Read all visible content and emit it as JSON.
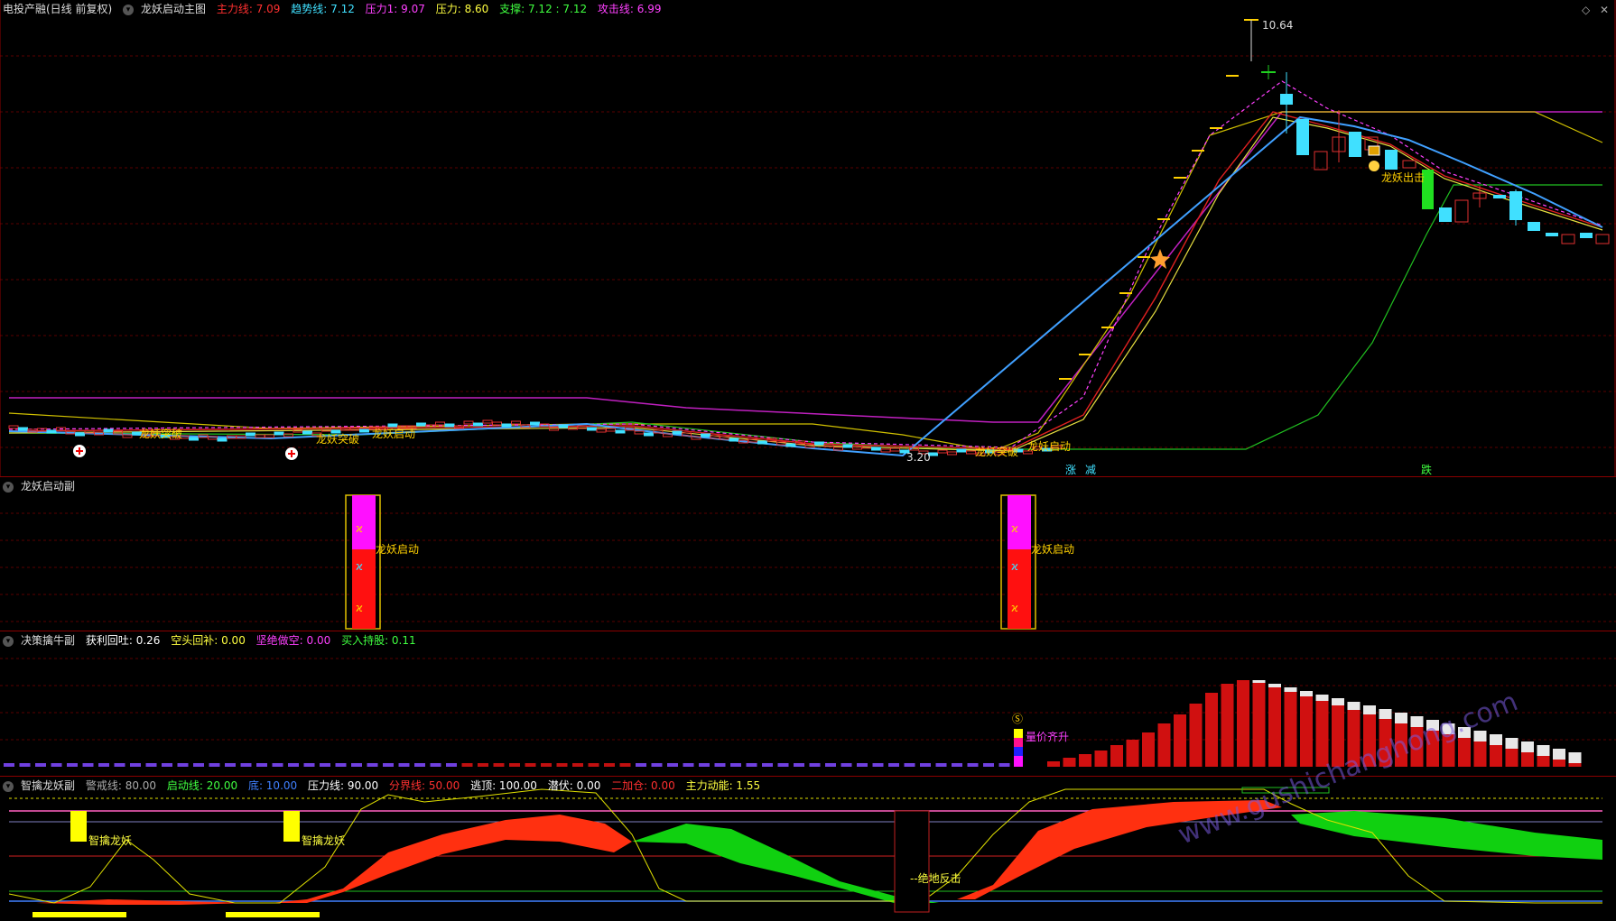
{
  "main": {
    "stock": "电投产融(日线 前复权)",
    "indicator": "龙妖启动主图",
    "params": [
      {
        "label": "主力线: 7.09",
        "color": "#ff3030"
      },
      {
        "label": "趋势线: 7.12",
        "color": "#40e0ff"
      },
      {
        "label": "压力1: 9.07",
        "color": "#ff40ff"
      },
      {
        "label": "压力: 8.60",
        "color": "#ffff40"
      },
      {
        "label": "支撑: 7.12 : 7.12",
        "color": "#40ff40"
      },
      {
        "label": "攻击线: 6.99",
        "color": "#ff40ff"
      }
    ],
    "high_label": "10.64",
    "low_label": "3.20",
    "annotations": {
      "breakout1": "龙妖突破",
      "breakout2": "龙妖突破",
      "launch1": "龙妖启动",
      "breakout3": "龙妖突破",
      "launch2": "龙妖启动",
      "strike": "龙妖出击",
      "tag_a": "涨",
      "tag_b": "减",
      "tag_c": "跌"
    }
  },
  "sub1": {
    "title": "龙妖启动副",
    "launch_a": "龙妖启动",
    "launch_b": "龙妖启动"
  },
  "sub2": {
    "title": "决策擒牛副",
    "params": [
      {
        "label": "获利回吐: 0.26",
        "color": "#ffffff"
      },
      {
        "label": "空头回补: 0.00",
        "color": "#ffff40"
      },
      {
        "label": "坚绝做空: 0.00",
        "color": "#ff40ff"
      },
      {
        "label": "买入持股: 0.11",
        "color": "#40ff40"
      }
    ],
    "signal": "量价齐升"
  },
  "sub3": {
    "title": "智擒龙妖副",
    "params": [
      {
        "label": "警戒线: 80.00",
        "color": "#aaaaaa"
      },
      {
        "label": "启动线: 20.00",
        "color": "#40ff40"
      },
      {
        "label": "底: 10.00",
        "color": "#4080ff"
      },
      {
        "label": "压力线: 90.00",
        "color": "#ffffff"
      },
      {
        "label": "分界线: 50.00",
        "color": "#ff3030"
      },
      {
        "label": "逃顶: 100.00",
        "color": "#ffffff"
      },
      {
        "label": "潜伏: 0.00",
        "color": "#ffffff"
      },
      {
        "label": "二加仓: 0.00",
        "color": "#ff3030"
      },
      {
        "label": "主力动能: 1.55",
        "color": "#ffff40"
      }
    ],
    "smart1": "智擒龙妖",
    "smart2": "智擒龙妖",
    "counter": "绝地反击"
  },
  "watermark": "www.gushichanghong.com"
}
